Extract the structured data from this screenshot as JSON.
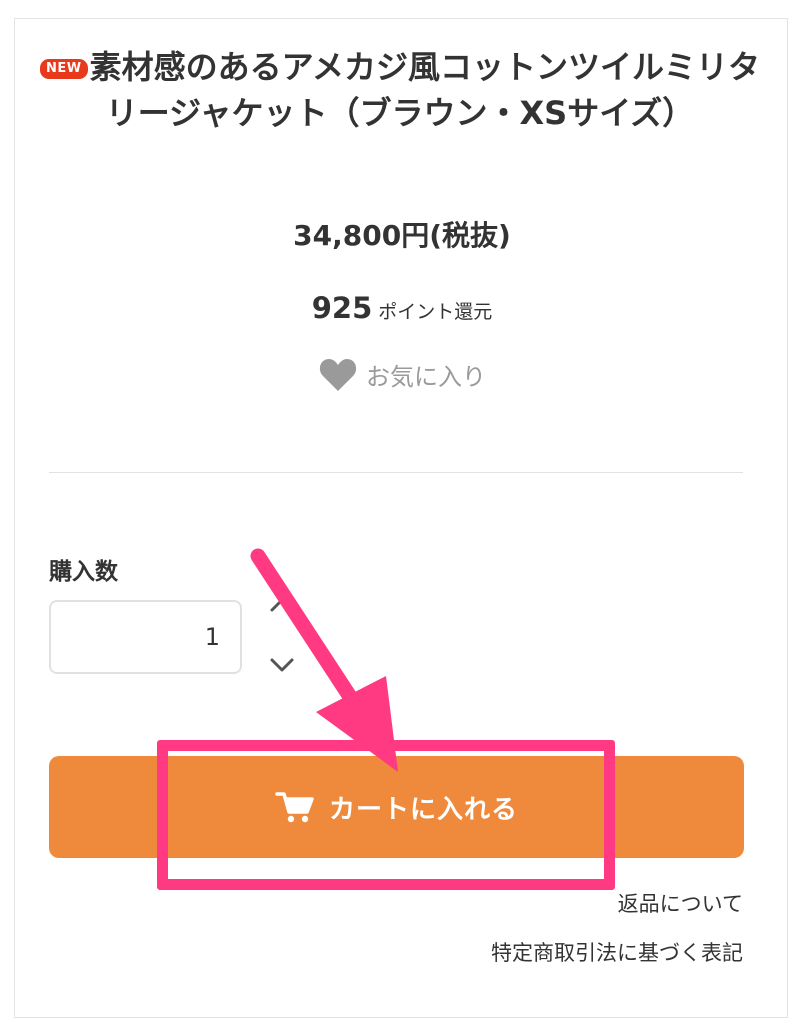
{
  "product": {
    "badge": "NEW",
    "title": "素材感のあるアメカジ風コットンツイルミリタリージャケット（ブラウン・XSサイズ）",
    "price": "34,800円(税抜)",
    "points_value": "925",
    "points_label": "ポイント還元",
    "favorite_label": "お気に入り"
  },
  "quantity": {
    "label": "購入数",
    "value": "1"
  },
  "cart": {
    "button_label": "カートに入れる"
  },
  "links": {
    "returns": "返品について",
    "legal": "特定商取引法に基づく表記"
  },
  "colors": {
    "cart_button": "#ef8a3c",
    "annotation": "#ff3a83",
    "badge": "#e8391c"
  },
  "icons": [
    "heart-icon",
    "chevron-up-icon",
    "chevron-down-icon",
    "cart-icon"
  ]
}
